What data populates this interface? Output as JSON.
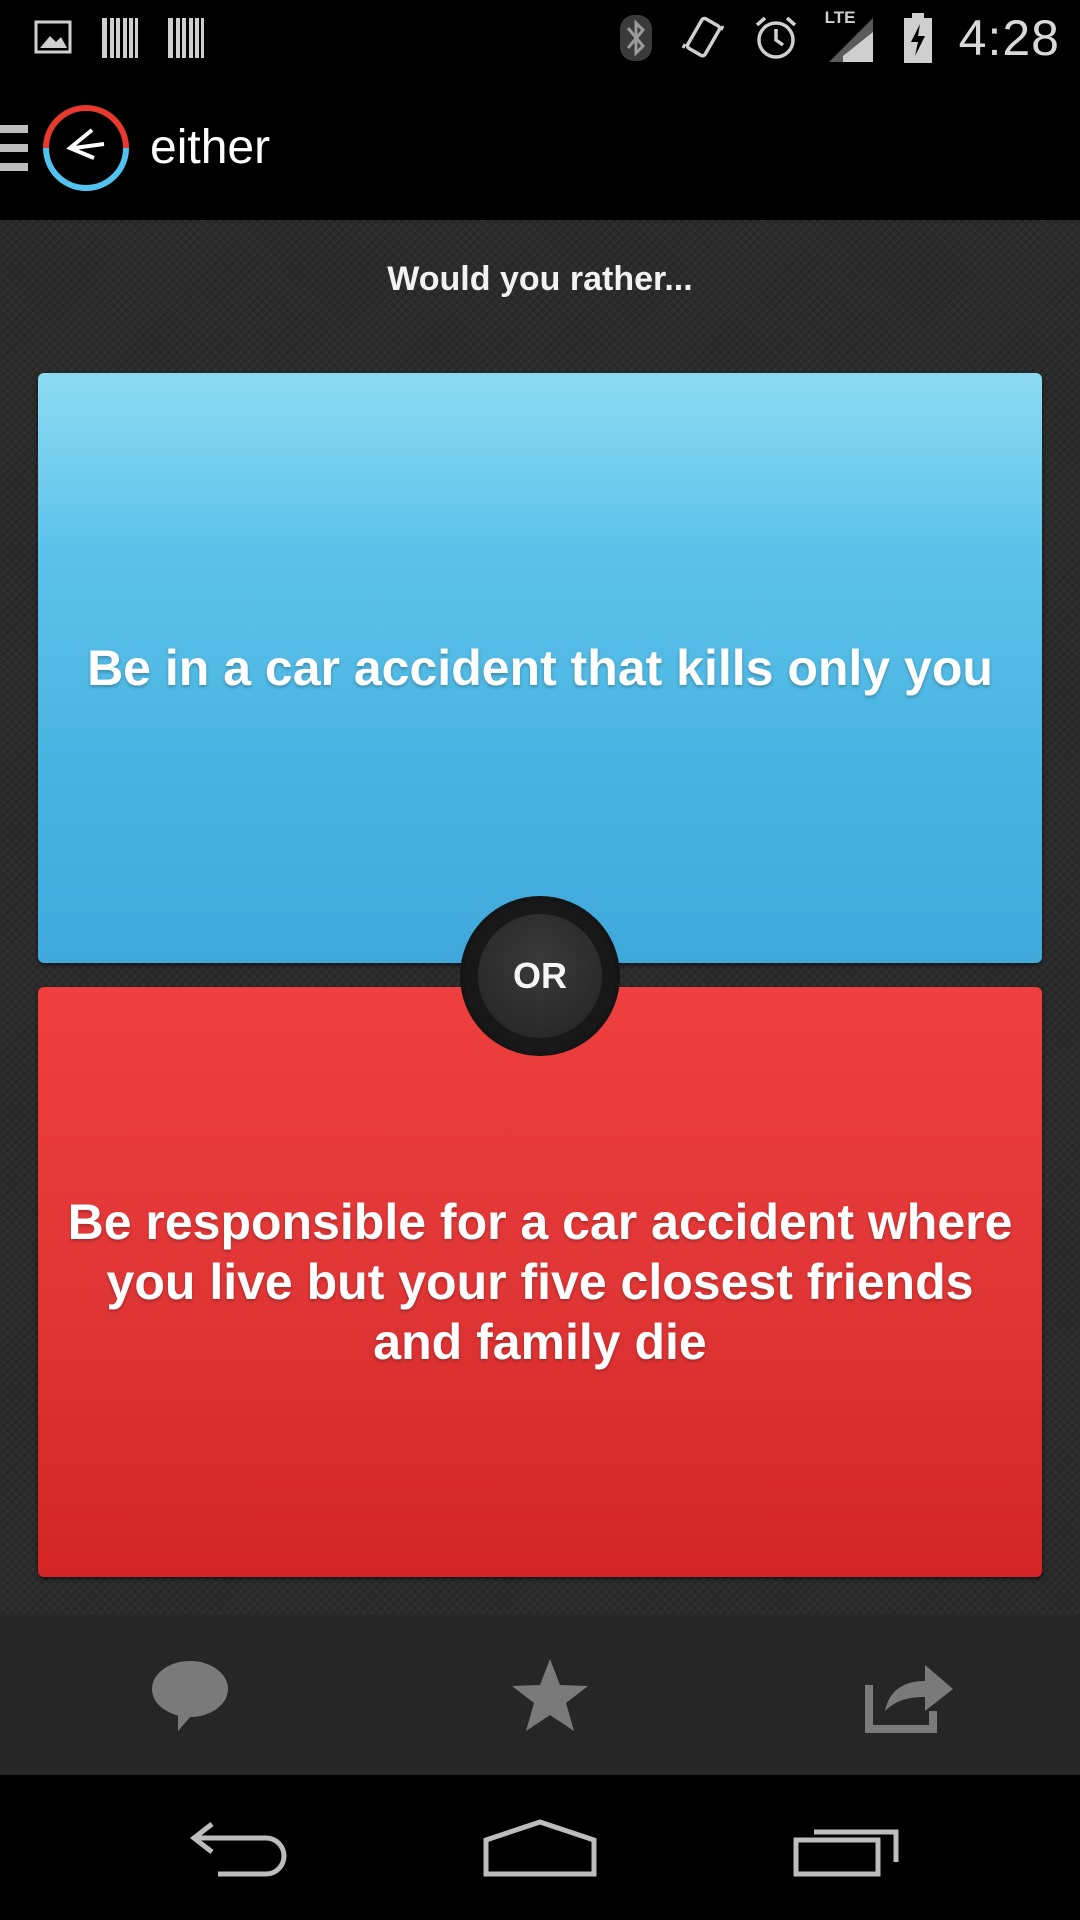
{
  "status_bar": {
    "time": "4:28",
    "icons": [
      "image-icon",
      "barcode-icon",
      "barcode-icon",
      "bluetooth-icon",
      "vibrate-icon",
      "alarm-icon",
      "lte-signal-icon",
      "battery-icon"
    ],
    "network_label": "LTE"
  },
  "app_bar": {
    "title": "either",
    "icons": [
      "menu-icon",
      "app-logo-icon"
    ]
  },
  "question": {
    "prompt": "Would you rather...",
    "option_a": "Be in a car accident that kills only you",
    "option_b": "Be responsible for a car accident where you live but your five closest friends and family die",
    "separator": "OR"
  },
  "colors": {
    "option_a": "#47b2e0",
    "option_b": "#e13636",
    "background": "#2b2b2b",
    "logo_red": "#e8392f",
    "logo_blue": "#52c3ef"
  },
  "action_bar": {
    "icons": [
      "comment-icon",
      "star-icon",
      "share-icon"
    ]
  },
  "nav_bar": {
    "icons": [
      "back-icon",
      "home-icon",
      "recent-apps-icon"
    ]
  }
}
